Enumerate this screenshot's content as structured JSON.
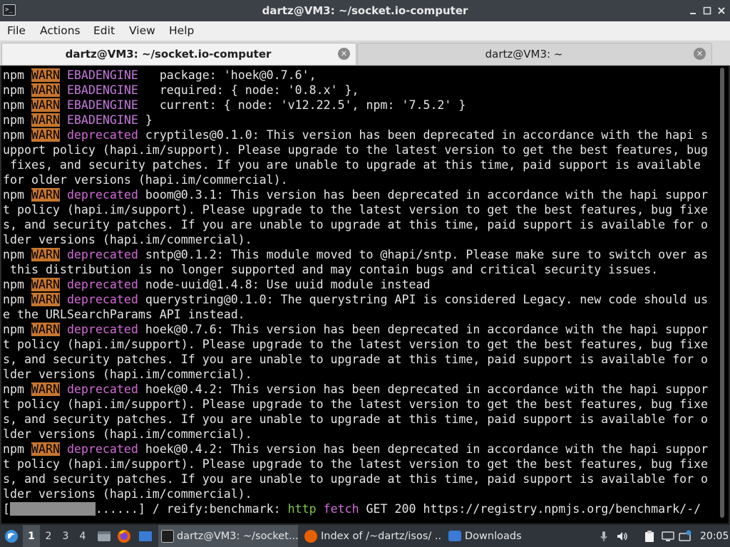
{
  "window": {
    "title": "dartz@VM3: ~/socket.io-computer",
    "app_icon": ">_",
    "controls": [
      "minimize-icon",
      "maximize-icon",
      "close-icon"
    ]
  },
  "menu": [
    "File",
    "Actions",
    "Edit",
    "View",
    "Help"
  ],
  "tabs": [
    {
      "label": "dartz@VM3: ~/socket.io-computer",
      "active": true
    },
    {
      "label": "dartz@VM3: ~",
      "active": false
    }
  ],
  "terminal": {
    "lines": [
      {
        "prefix": "npm ",
        "warn": "WARN",
        "tag": "EBADENGINE",
        "tag_type": "ebad",
        "text": "   package: 'hoek@0.7.6',"
      },
      {
        "prefix": "npm ",
        "warn": "WARN",
        "tag": "EBADENGINE",
        "tag_type": "ebad",
        "text": "   required: { node: '0.8.x' },"
      },
      {
        "prefix": "npm ",
        "warn": "WARN",
        "tag": "EBADENGINE",
        "tag_type": "ebad",
        "text": "   current: { node: 'v12.22.5', npm: '7.5.2' }"
      },
      {
        "prefix": "npm ",
        "warn": "WARN",
        "tag": "EBADENGINE",
        "tag_type": "ebad",
        "text": " }"
      },
      {
        "prefix": "npm ",
        "warn": "WARN",
        "tag": "deprecated",
        "tag_type": "depr",
        "text": " cryptiles@0.1.0: This version has been deprecated in accordance with the hapi s"
      },
      {
        "text": "upport policy (hapi.im/support). Please upgrade to the latest version to get the best features, bug"
      },
      {
        "text": " fixes, and security patches. If you are unable to upgrade at this time, paid support is available"
      },
      {
        "text": "for older versions (hapi.im/commercial)."
      },
      {
        "prefix": "npm ",
        "warn": "WARN",
        "tag": "deprecated",
        "tag_type": "depr",
        "text": " boom@0.3.1: This version has been deprecated in accordance with the hapi suppor"
      },
      {
        "text": "t policy (hapi.im/support). Please upgrade to the latest version to get the best features, bug fixe"
      },
      {
        "text": "s, and security patches. If you are unable to upgrade at this time, paid support is available for o"
      },
      {
        "text": "lder versions (hapi.im/commercial)."
      },
      {
        "prefix": "npm ",
        "warn": "WARN",
        "tag": "deprecated",
        "tag_type": "depr",
        "text": " sntp@0.1.2: This module moved to @hapi/sntp. Please make sure to switch over as"
      },
      {
        "text": " this distribution is no longer supported and may contain bugs and critical security issues."
      },
      {
        "prefix": "npm ",
        "warn": "WARN",
        "tag": "deprecated",
        "tag_type": "depr",
        "text": " node-uuid@1.4.8: Use uuid module instead"
      },
      {
        "prefix": "npm ",
        "warn": "WARN",
        "tag": "deprecated",
        "tag_type": "depr",
        "text": " querystring@0.1.0: The querystring API is considered Legacy. new code should us"
      },
      {
        "text": "e the URLSearchParams API instead."
      },
      {
        "prefix": "npm ",
        "warn": "WARN",
        "tag": "deprecated",
        "tag_type": "depr",
        "text": " hoek@0.7.6: This version has been deprecated in accordance with the hapi suppor"
      },
      {
        "text": "t policy (hapi.im/support). Please upgrade to the latest version to get the best features, bug fixe"
      },
      {
        "text": "s, and security patches. If you are unable to upgrade at this time, paid support is available for o"
      },
      {
        "text": "lder versions (hapi.im/commercial)."
      },
      {
        "prefix": "npm ",
        "warn": "WARN",
        "tag": "deprecated",
        "tag_type": "depr",
        "text": " hoek@0.4.2: This version has been deprecated in accordance with the hapi suppor"
      },
      {
        "text": "t policy (hapi.im/support). Please upgrade to the latest version to get the best features, bug fixe"
      },
      {
        "text": "s, and security patches. If you are unable to upgrade at this time, paid support is available for o"
      },
      {
        "text": "lder versions (hapi.im/commercial)."
      },
      {
        "prefix": "npm ",
        "warn": "WARN",
        "tag": "deprecated",
        "tag_type": "depr",
        "text": " hoek@0.4.2: This version has been deprecated in accordance with the hapi suppor"
      },
      {
        "text": "t policy (hapi.im/support). Please upgrade to the latest version to get the best features, bug fixe"
      },
      {
        "text": "s, and security patches. If you are unable to upgrade at this time, paid support is available for o"
      },
      {
        "text": "lder versions (hapi.im/commercial)."
      }
    ],
    "progress": {
      "open": "[",
      "bar": "############",
      "rest": "......] / reify:benchmark: ",
      "http": "http",
      "fetch": "fetch",
      "tail": " GET 200 https://registry.npmjs.org/benchmark/-/"
    }
  },
  "taskbar": {
    "start_icon": "start-menu-icon",
    "workspaces": [
      "1",
      "2",
      "3",
      "4"
    ],
    "active_workspace": "1",
    "launchers": [
      "file-manager-icon",
      "firefox-icon",
      "show-desktop-icon"
    ],
    "tasks": [
      {
        "label": "dartz@VM3: ~/socket....",
        "icon": "terminal-icon",
        "active": true
      },
      {
        "label": "Index of /~dartz/isos/ ...",
        "icon": "firefox-icon",
        "active": false
      },
      {
        "label": "Downloads",
        "icon": "folder-icon",
        "active": false
      }
    ],
    "tray": [
      "mic-icon",
      "volume-icon",
      "clipboard-icon",
      "display-icon",
      "network-icon"
    ],
    "clock": "20:05"
  }
}
